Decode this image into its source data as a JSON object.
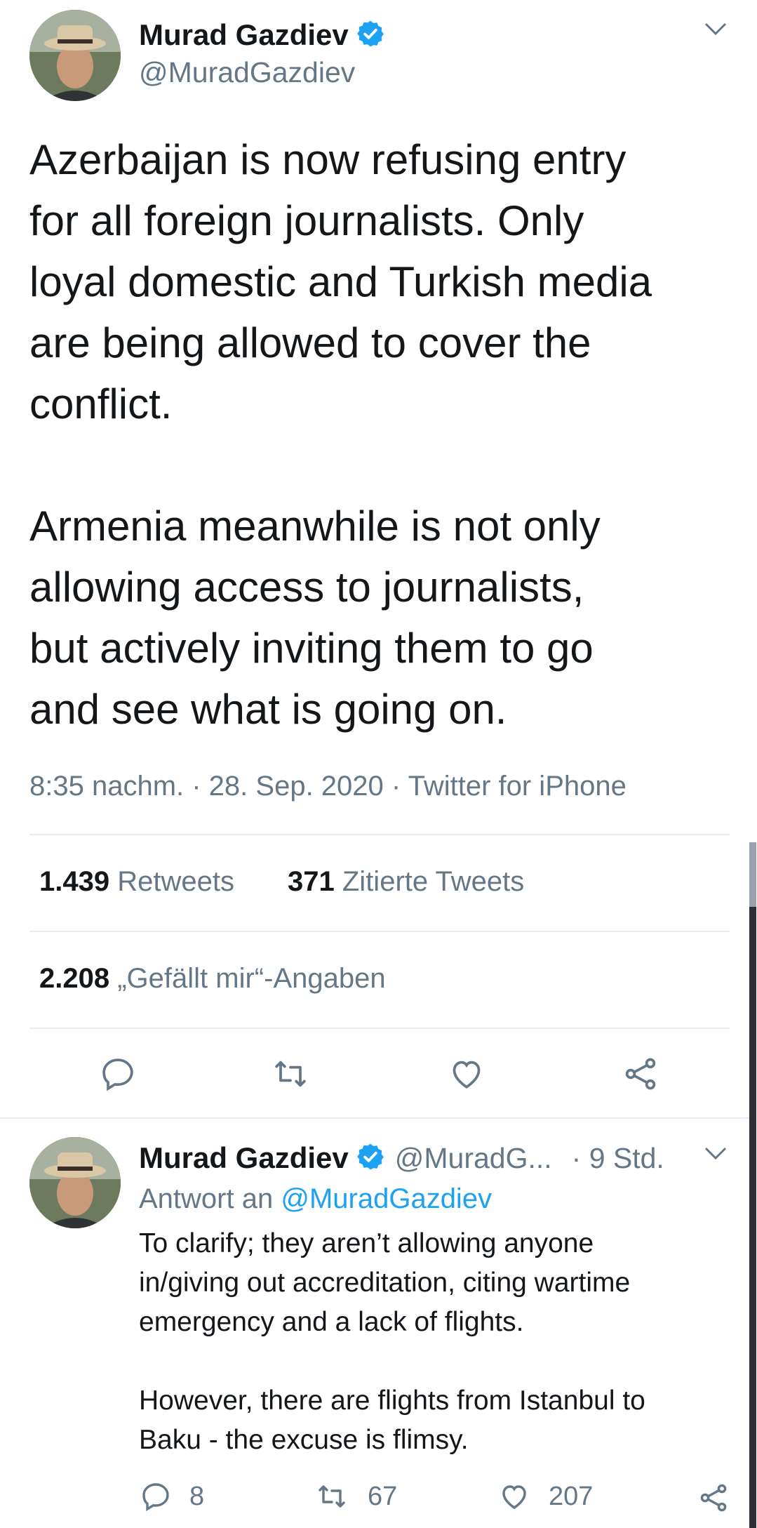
{
  "tweet": {
    "author_name": "Murad Gazdiev",
    "author_handle": "@MuradGazdiev",
    "text": "Azerbaijan is now refusing entry\nfor all foreign journalists. Only\nloyal domestic and Turkish media\nare being allowed to cover the\nconflict.\n\nArmenia meanwhile is not only\nallowing access to journalists,\nbut actively inviting them to go\nand see what is going on.",
    "meta": "8:35 nachm. · 28. Sep. 2020 · Twitter for iPhone",
    "retweets_count": "1.439",
    "retweets_label": "Retweets",
    "quotes_count": "371",
    "quotes_label": "Zitierte Tweets",
    "likes_count": "2.208",
    "likes_label": "„Gefällt mir“-Angaben"
  },
  "reply": {
    "author_name": "Murad Gazdiev",
    "author_handle": "@MuradG...",
    "time": "· 9 Std.",
    "reply_to_prefix": "Antwort an",
    "reply_to_handle": "@MuradGazdiev",
    "text": "To clarify; they aren’t allowing  anyone\nin/giving out accreditation, citing wartime\nemergency and a lack of flights.\n\nHowever, there are flights from Istanbul to\nBaku - the excuse is flimsy.",
    "reply_count": "8",
    "retweet_count": "67",
    "like_count": "207"
  },
  "colors": {
    "verified": "#1da1f2",
    "secondary_text": "#657786",
    "divider": "#e6ecf0"
  },
  "icons": [
    "chevron-down-icon",
    "verified-badge-icon",
    "reply-icon",
    "retweet-icon",
    "like-icon",
    "share-icon"
  ]
}
